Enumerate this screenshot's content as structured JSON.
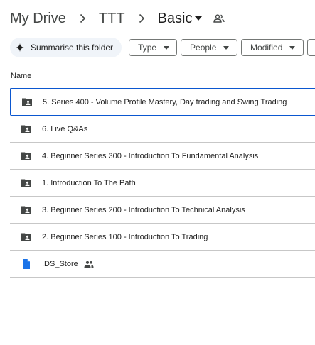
{
  "breadcrumb": {
    "root": "My Drive",
    "parent": "TTT",
    "current": "Basic"
  },
  "toolbar": {
    "summarise_label": "Summarise this folder",
    "filters": [
      "Type",
      "People",
      "Modified"
    ]
  },
  "list": {
    "name_header": "Name",
    "items": [
      {
        "name": "5. Series 400 - Volume Profile Mastery, Day trading and Swing Trading",
        "icon": "shared-folder-icon"
      },
      {
        "name": "6. Live Q&As",
        "icon": "shared-folder-icon"
      },
      {
        "name": "4. Beginner Series 300 - Introduction To Fundamental Analysis",
        "icon": "shared-folder-icon"
      },
      {
        "name": "1. Introduction To The Path",
        "icon": "shared-folder-icon"
      },
      {
        "name": "3. Beginner Series 200 - Introduction To Technical Analysis",
        "icon": "shared-folder-icon"
      },
      {
        "name": "2. Beginner Series 100 - Introduction To Trading",
        "icon": "shared-folder-icon"
      },
      {
        "name": ".DS_Store",
        "icon": "file-icon"
      }
    ]
  },
  "colors": {
    "accent": "#0b57d0",
    "folder_icon": "#444746",
    "file_icon": "#1a73e8",
    "chip_bg": "#f0f4f9"
  }
}
